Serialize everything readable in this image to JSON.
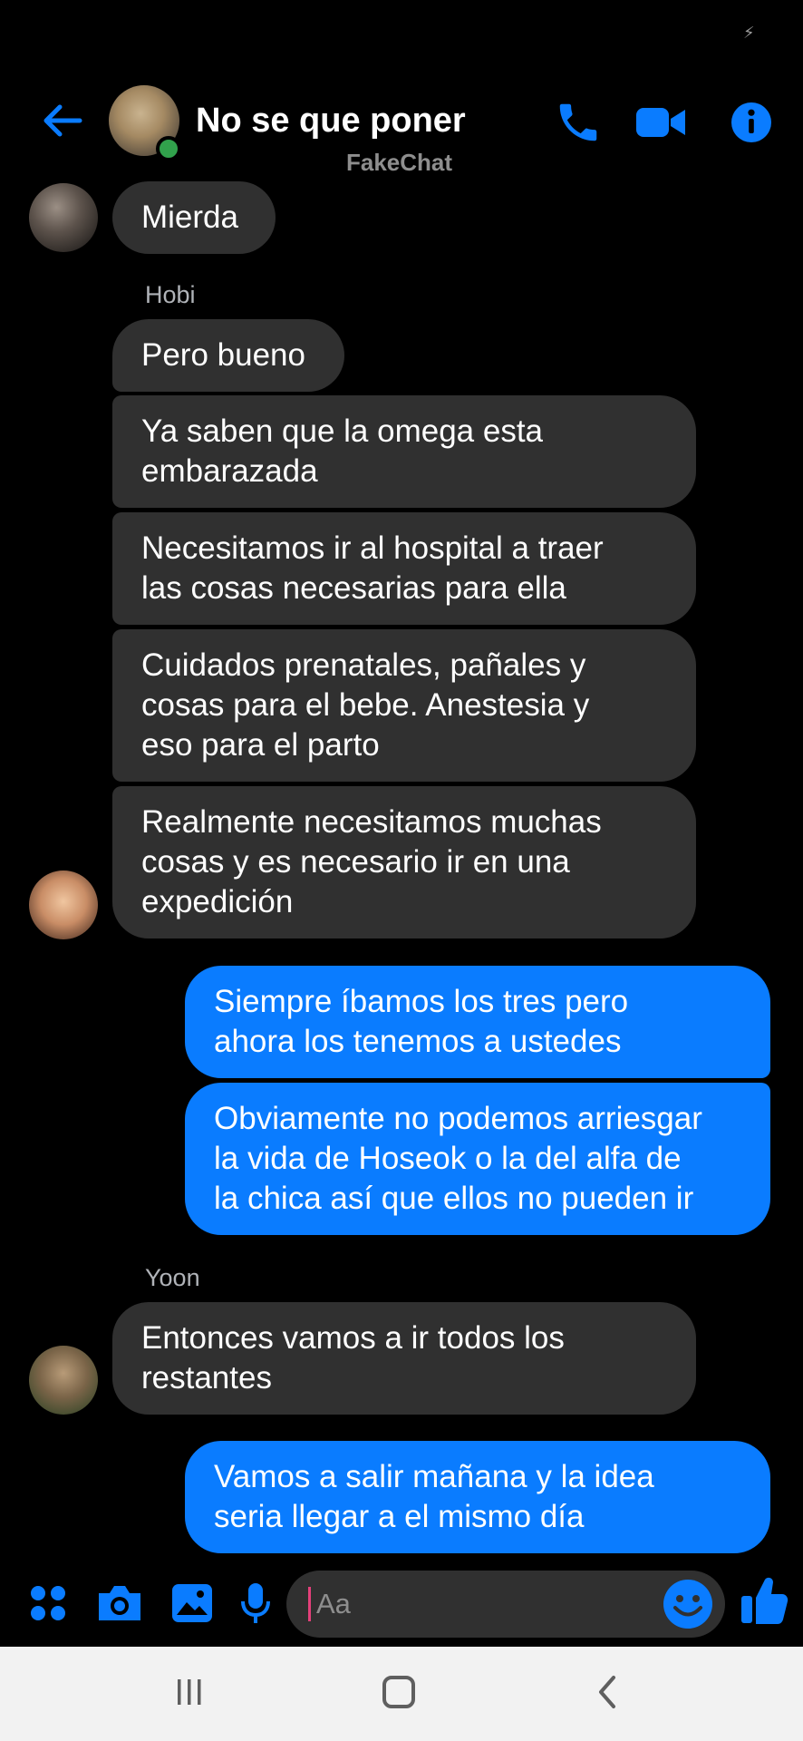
{
  "status_bar": {
    "icon": "charging-icon"
  },
  "header": {
    "back_icon": "back-arrow-icon",
    "title": "No se que poner",
    "subtitle": "FakeChat",
    "online": true,
    "actions": [
      "phone-icon",
      "video-camera-icon",
      "info-icon"
    ],
    "accent_color": "#0a7cff"
  },
  "messages": [
    {
      "direction": "incoming",
      "text": "Mierda"
    },
    {
      "sender": "Hobi"
    },
    {
      "direction": "incoming",
      "text": "Pero bueno"
    },
    {
      "direction": "incoming",
      "lines": [
        "Ya saben que la omega esta",
        "embarazada"
      ]
    },
    {
      "direction": "incoming",
      "lines": [
        "Necesitamos ir al hospital a traer",
        "las cosas necesarias para ella"
      ]
    },
    {
      "direction": "incoming",
      "lines": [
        "Cuidados prenatales, pañales y",
        "cosas para el bebe. Anestesia y",
        "eso para el parto"
      ]
    },
    {
      "direction": "incoming",
      "lines": [
        "Realmente necesitamos muchas",
        "cosas y es necesario ir en una",
        "expedición"
      ]
    },
    {
      "direction": "outgoing",
      "lines": [
        "Siempre íbamos los tres pero",
        "ahora los tenemos a ustedes"
      ]
    },
    {
      "direction": "outgoing",
      "lines": [
        "Obviamente no podemos arriesgar",
        "la vida de Hoseok o la del alfa de",
        "la chica así que ellos no pueden ir"
      ]
    },
    {
      "sender": "Yoon"
    },
    {
      "direction": "incoming",
      "lines": [
        "Entonces vamos a ir todos los",
        "restantes"
      ]
    },
    {
      "direction": "outgoing",
      "lines": [
        "Vamos a salir mañana y la idea",
        "seria llegar a el mismo día"
      ]
    }
  ],
  "composer": {
    "icons": [
      "apps-icon",
      "camera-icon",
      "gallery-icon",
      "microphone-icon"
    ],
    "placeholder": "Aa",
    "emoji_icon": "emoji-icon",
    "send_icon": "thumbs-up-icon"
  },
  "nav_bar": {
    "buttons": [
      "recent-apps-icon",
      "home-icon",
      "back-icon"
    ]
  }
}
